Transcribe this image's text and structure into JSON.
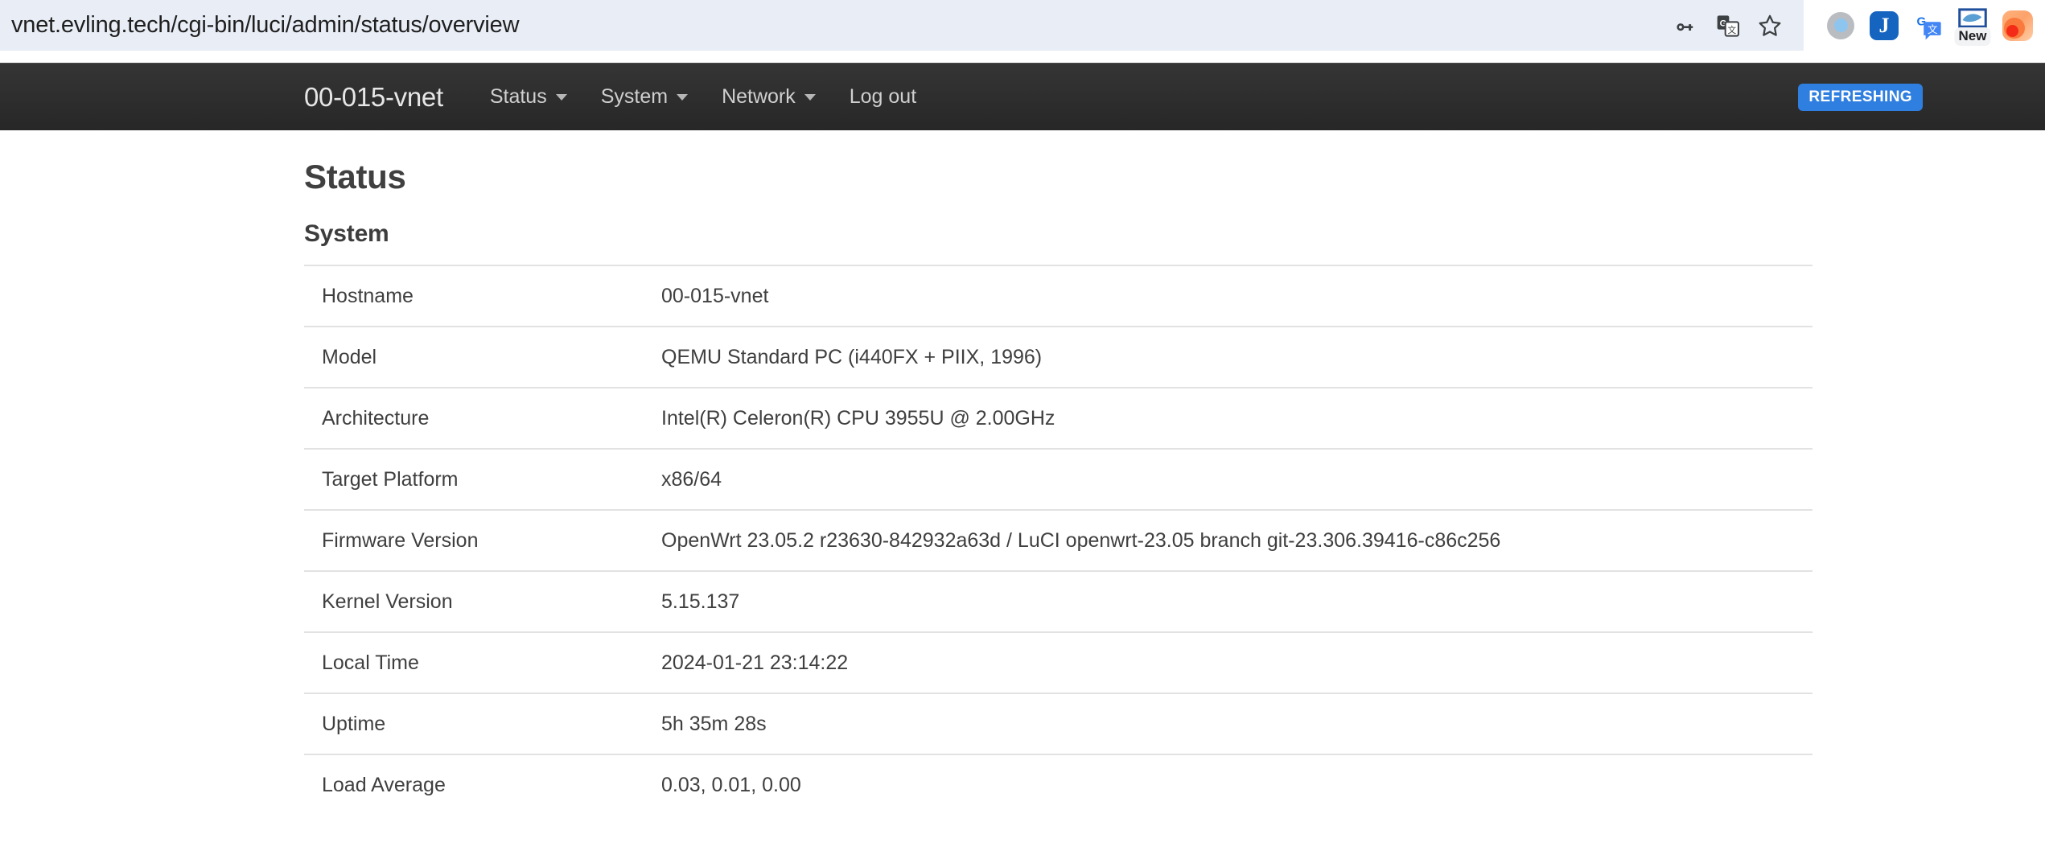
{
  "browser": {
    "url": "vnet.evling.tech/cgi-bin/luci/admin/status/overview",
    "omnibox_actions": [
      {
        "name": "password-key-icon"
      },
      {
        "name": "translate-icon"
      },
      {
        "name": "bookmark-star-icon"
      }
    ],
    "extensions": [
      {
        "name": "profile-avatar-icon"
      },
      {
        "name": "jdownloader-extension-icon",
        "letter": "J"
      },
      {
        "name": "google-translate-extension-icon",
        "letter": "G"
      },
      {
        "name": "new-extension-icon",
        "badge": "New"
      },
      {
        "name": "rss-extension-icon"
      }
    ]
  },
  "navbar": {
    "brand": "00-015-vnet",
    "menu": [
      {
        "label": "Status",
        "has_caret": true
      },
      {
        "label": "System",
        "has_caret": true
      },
      {
        "label": "Network",
        "has_caret": true
      },
      {
        "label": "Log out",
        "has_caret": false
      }
    ],
    "status_badge": "REFRESHING",
    "status_badge_color": "#2f7fe0"
  },
  "page": {
    "title": "Status",
    "section": "System",
    "rows": [
      {
        "label": "Hostname",
        "value": "00-015-vnet"
      },
      {
        "label": "Model",
        "value": "QEMU Standard PC (i440FX + PIIX, 1996)"
      },
      {
        "label": "Architecture",
        "value": "Intel(R) Celeron(R) CPU 3955U @ 2.00GHz"
      },
      {
        "label": "Target Platform",
        "value": "x86/64"
      },
      {
        "label": "Firmware Version",
        "value": "OpenWrt 23.05.2 r23630-842932a63d / LuCI openwrt-23.05 branch git-23.306.39416-c86c256"
      },
      {
        "label": "Kernel Version",
        "value": "5.15.137"
      },
      {
        "label": "Local Time",
        "value": "2024-01-21 23:14:22"
      },
      {
        "label": "Uptime",
        "value": "5h 35m 28s"
      },
      {
        "label": "Load Average",
        "value": "0.03, 0.01, 0.00"
      }
    ]
  }
}
